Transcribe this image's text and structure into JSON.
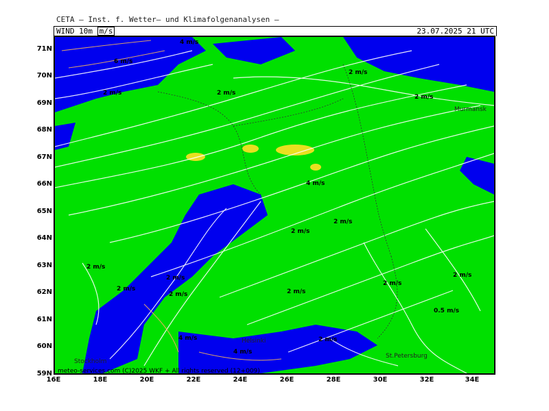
{
  "header": {
    "institute": "CETA — Inst. f. Wetter— und Klimafolgenanalysen —",
    "parameter": "WIND 10m",
    "unit": "m/s",
    "valid_time": "23.07.2025  21 UTC"
  },
  "footer": {
    "copyright": "meteo-services.com (C)2025 WKF + All rights reserved (12+009)"
  },
  "axes": {
    "lat_labels": [
      "71N",
      "70N",
      "69N",
      "68N",
      "67N",
      "66N",
      "65N",
      "64N",
      "63N",
      "62N",
      "61N",
      "60N",
      "59N"
    ],
    "lon_labels": [
      "16E",
      "18E",
      "20E",
      "22E",
      "24E",
      "26E",
      "28E",
      "30E",
      "32E",
      "34E"
    ]
  },
  "cities": [
    "Murmansk",
    "Helsinki",
    "Stockholm",
    "St.Petersburg"
  ],
  "speed_labels": [
    "4 m/s",
    "6 m/s",
    "2 m/s",
    "2 m/s",
    "2 m/s",
    "2 m/s",
    "4 m/s",
    "2 m/s",
    "2 m/s",
    "2 m/s",
    "2 m/s",
    "2 m/s",
    "2 m/s",
    "2 m/s",
    "2 m/s",
    "0.5 m/s",
    "4 m/s",
    "4 m/s",
    "2 m/s",
    "2 m/s"
  ],
  "colors": {
    "low_wind": "#0000ee",
    "mid_wind": "#00e000",
    "high_wind": "#f0e020",
    "streamline": "#ffffff",
    "streamline_low": "#f0b060"
  }
}
